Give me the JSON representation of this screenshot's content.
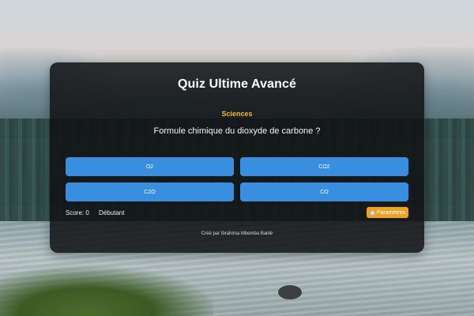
{
  "quiz": {
    "title": "Quiz Ultime Avancé",
    "category": "Sciences",
    "question": "Formule chimique du dioxyde de carbone ?",
    "answers": [
      "O2",
      "CO2",
      "C2O",
      "CO"
    ]
  },
  "status": {
    "score": "Score: 0",
    "level": "Débutant"
  },
  "settings": {
    "label": "Paramètres",
    "icon": "gear-icon"
  },
  "footer": {
    "credit": "Créé par Ibrahima Mbemba Baldé"
  },
  "colors": {
    "answer_button": "#3a8ee0",
    "settings_button": "#f0a21c",
    "category_text": "#f5b62a"
  }
}
